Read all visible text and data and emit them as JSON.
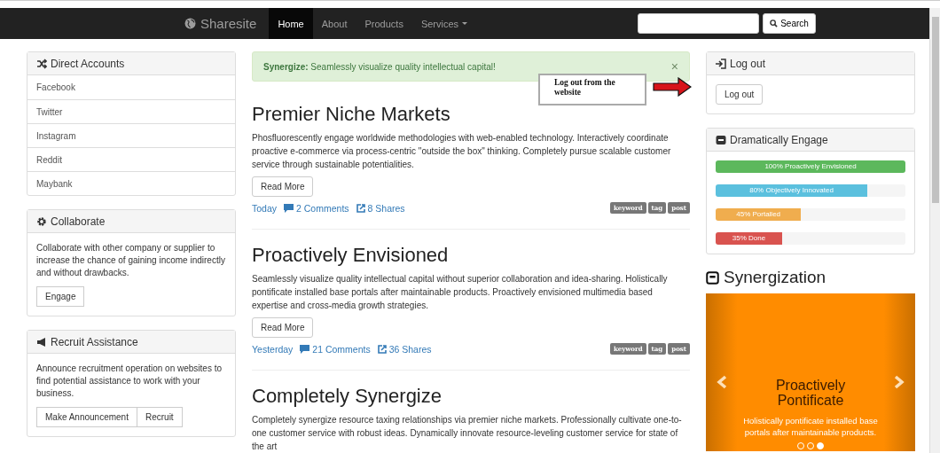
{
  "navbar": {
    "brand": "Sharesite",
    "items": [
      {
        "label": "Home",
        "selected": true,
        "kind": "link"
      },
      {
        "label": "About",
        "selected": false,
        "kind": "link"
      },
      {
        "label": "Products",
        "selected": false,
        "kind": "link"
      },
      {
        "label": "Services",
        "selected": false,
        "kind": "dropdown"
      }
    ],
    "search": {
      "button": "Search"
    }
  },
  "left_panels": [
    {
      "kind": "list",
      "title": "Direct Accounts",
      "items": [
        "Facebook",
        "Twitter",
        "Instagram",
        "Reddit",
        "Maybank"
      ]
    },
    {
      "kind": "text",
      "title": "Collaborate",
      "text": "Collaborate with other company or supplier to increase the chance of gaining income indirectly and without drawbacks.",
      "buttons": [
        "Engage"
      ]
    },
    {
      "kind": "text",
      "title": "Recruit Assistance",
      "text": "Announce recruitment operation on websites to find potential assistance to work with your business.",
      "buttons": [
        "Make Announcement",
        "Recruit"
      ]
    }
  ],
  "alert": {
    "text": "**Synergize:** Seamlessly visualize quality intellectual capital!",
    "close": "×"
  },
  "annotation": {
    "text": "Log out from the website"
  },
  "articles": [
    {
      "title": "Premier Niche Markets",
      "body": "Phosfluorescently engage worldwide methodologies with web-enabled technology. Interactively coordinate proactive e-commerce via process-centric \"outside the box\" thinking. Completely pursue scalable customer service through sustainable potentialities.",
      "button": "Read More",
      "date": "Today",
      "comments": "2 Comments",
      "shares": "8 Shares",
      "tags": [
        "keyword",
        "tag",
        "post"
      ]
    },
    {
      "title": "Proactively Envisioned",
      "body": "Seamlessly visualize quality intellectual capital without superior collaboration and idea-sharing. Holistically pontificate installed base portals after maintainable products. Proactively envisioned multimedia based expertise and cross-media growth strategies.",
      "button": "Read More",
      "date": "Yesterday",
      "comments": "21 Comments",
      "shares": "36 Shares",
      "tags": [
        "keyword",
        "tag",
        "post"
      ]
    },
    {
      "title": "Completely Synergize",
      "body": "Completely synergize resource taxing relationships via premier niche markets. Professionally cultivate one-to-one customer service with robust ideas. Dynamically innovate resource-leveling customer service for state of the art"
    }
  ],
  "logout_panel": {
    "title": "Log out",
    "button": "Log out"
  },
  "engage_panel": {
    "title": "Dramatically Engage",
    "bars": [
      {
        "label": "100% Proactively Envisioned",
        "level": 1.0,
        "color": "#5cb85c"
      },
      {
        "label": "80% Objectively Innovated",
        "level": 0.8,
        "color": "#5bc0de"
      },
      {
        "label": "45% Portalled",
        "level": 0.45,
        "color": "#f0ad4e"
      },
      {
        "label": "35% Done",
        "level": 0.35,
        "color": "#d9534f"
      }
    ]
  },
  "synergization": {
    "title": "Synergization",
    "slide": {
      "title": "Proactively Pontificate",
      "caption": "Holistically pontificate installed base portals after maintainable products."
    },
    "indicators": [
      {
        "selected": false
      },
      {
        "selected": false
      },
      {
        "selected": true
      }
    ]
  }
}
